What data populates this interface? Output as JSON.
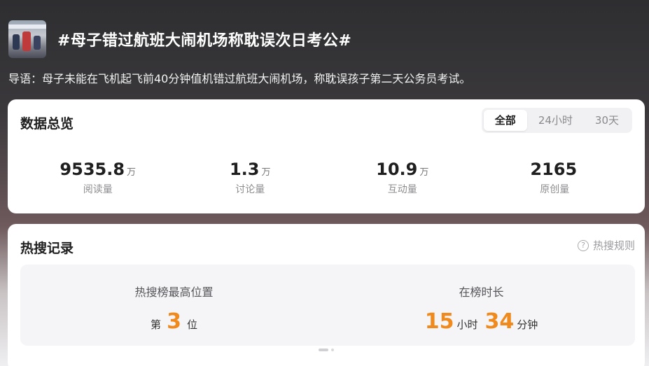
{
  "topic": {
    "title": "#母子错过航班大闹机场称耽误次日考公#",
    "lead": "导语：母子未能在飞机起飞前40分钟值机错过航班大闹机场，称耽误孩子第二天公务员考试。"
  },
  "overview": {
    "title": "数据总览",
    "tabs": [
      "全部",
      "24小时",
      "30天"
    ],
    "active_tab": "全部",
    "stats": [
      {
        "value": "9535.8",
        "unit": "万",
        "label": "阅读量"
      },
      {
        "value": "1.3",
        "unit": "万",
        "label": "讨论量"
      },
      {
        "value": "10.9",
        "unit": "万",
        "label": "互动量"
      },
      {
        "value": "2165",
        "unit": "",
        "label": "原创量"
      }
    ]
  },
  "hot_search": {
    "title": "热搜记录",
    "rules_label": "热搜规则",
    "rules_icon": "question-circle-icon",
    "peak": {
      "label": "热搜榜最高位置",
      "prefix": "第",
      "value": "3",
      "suffix": "位"
    },
    "duration": {
      "label": "在榜时长",
      "hours": "15",
      "hours_unit": "小时",
      "minutes": "34",
      "minutes_unit": "分钟"
    }
  },
  "colors": {
    "accent": "#f08a1c",
    "card_bg": "#ffffff"
  }
}
